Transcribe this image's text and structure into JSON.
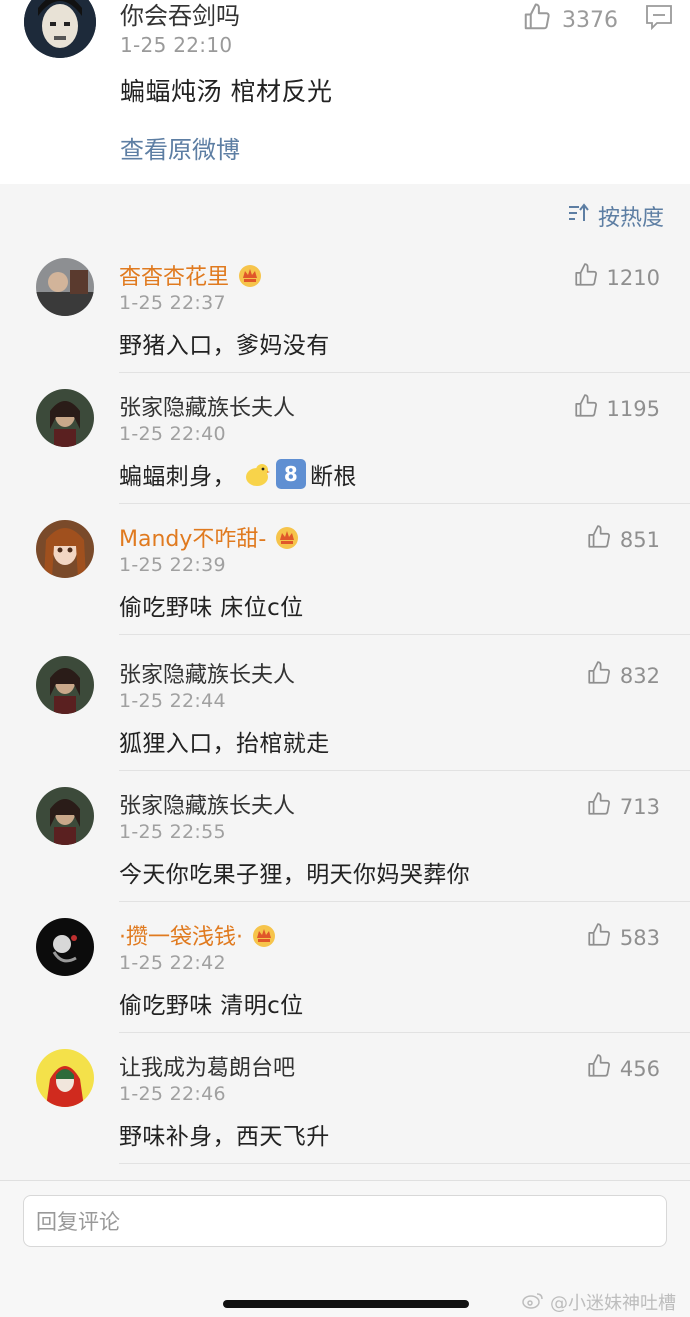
{
  "post": {
    "author": "你会吞剑吗",
    "time": "1-25 22:10",
    "text": "蝙蝠炖汤 棺材反光",
    "likes": "3376",
    "view_original": "查看原微博"
  },
  "sort_label": "按热度",
  "comments": [
    {
      "name": "杳杳杏花里",
      "time": "1-25 22:37",
      "text": "野猪入口，爹妈没有",
      "likes": "1210",
      "vip": true
    },
    {
      "name": "张家隐藏族长夫人",
      "time": "1-25 22:40",
      "text_before": "蝙蝠刺身，",
      "keycap": "8",
      "text_after": "断根",
      "likes": "1195",
      "vip": false
    },
    {
      "name": "Mandy不咋甜-",
      "time": "1-25 22:39",
      "text": "偷吃野味 床位c位",
      "likes": "851",
      "vip": true
    },
    {
      "name": "张家隐藏族长夫人",
      "time": "1-25 22:44",
      "text": "狐狸入口，抬棺就走",
      "likes": "832",
      "vip": false
    },
    {
      "name": "张家隐藏族长夫人",
      "time": "1-25 22:55",
      "text": "今天你吃果子狸，明天你妈哭葬你",
      "likes": "713",
      "vip": false
    },
    {
      "name": "·攒一袋浅钱·",
      "time": "1-25 22:42",
      "text": "偷吃野味 清明c位",
      "likes": "583",
      "vip": true
    },
    {
      "name": "让我成为葛朗台吧",
      "time": "1-25 22:46",
      "text": "野味补身，西天飞升",
      "likes": "456",
      "vip": false
    }
  ],
  "reply": {
    "placeholder": "回复评论"
  },
  "watermark": "@小迷妹神吐槽"
}
